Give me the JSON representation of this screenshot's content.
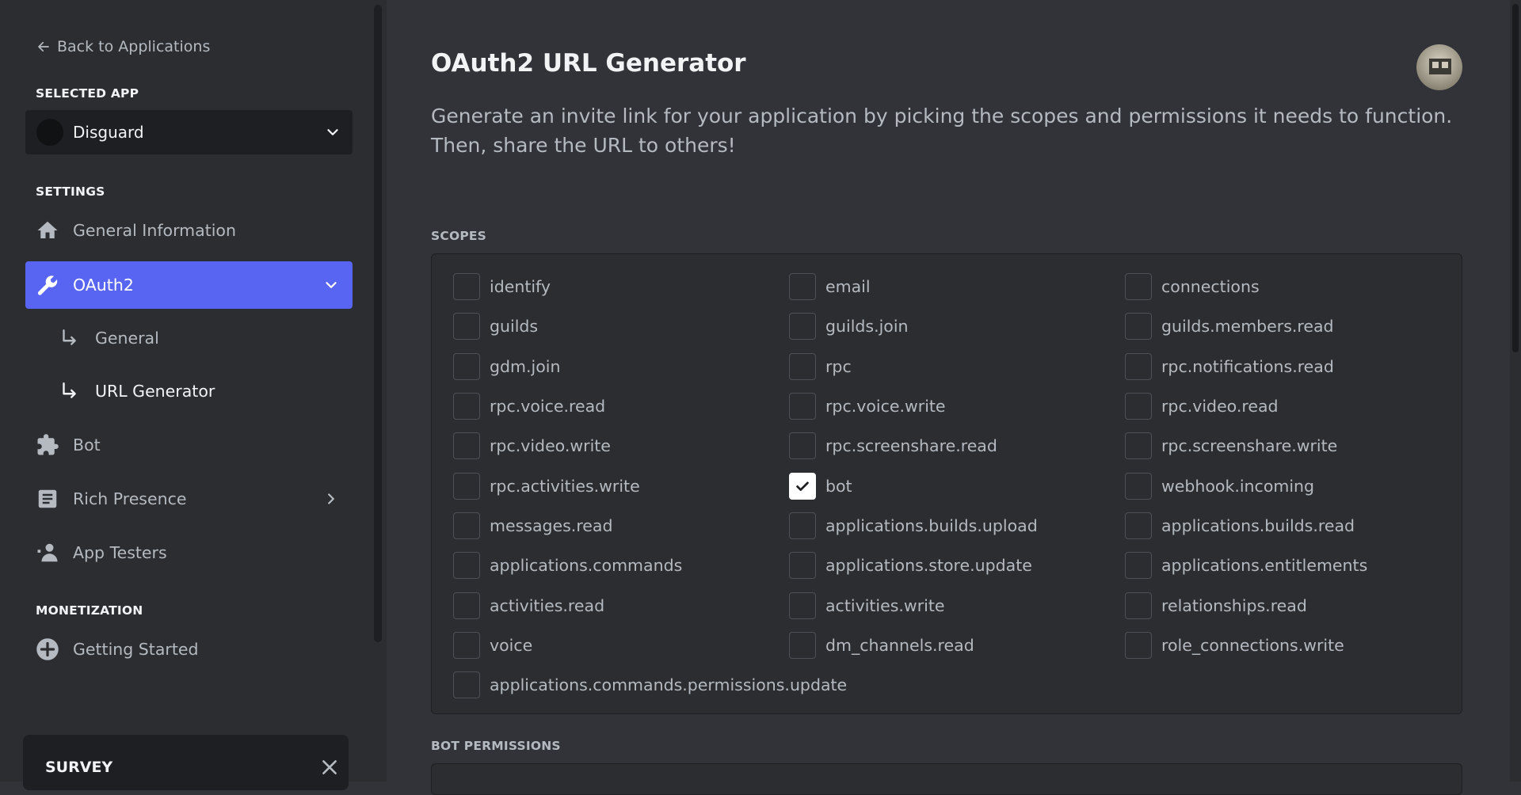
{
  "sidebar": {
    "back_label": "Back to Applications",
    "selected_app_heading": "SELECTED APP",
    "selected_app_name": "Disguard",
    "settings_heading": "SETTINGS",
    "items": [
      {
        "label": "General Information",
        "icon": "home-icon"
      },
      {
        "label": "OAuth2",
        "icon": "wrench-icon",
        "active": true
      },
      {
        "label": "Bot",
        "icon": "puzzle-icon"
      },
      {
        "label": "Rich Presence",
        "icon": "document-icon"
      },
      {
        "label": "App Testers",
        "icon": "user-icon"
      }
    ],
    "oauth_subitems": [
      {
        "label": "General"
      },
      {
        "label": "URL Generator",
        "current": true
      }
    ],
    "monetization_heading": "MONETIZATION",
    "monetization_items": [
      {
        "label": "Getting Started",
        "icon": "plus-circle-icon"
      }
    ],
    "survey_title": "SURVEY"
  },
  "main": {
    "title": "OAuth2 URL Generator",
    "description": "Generate an invite link for your application by picking the scopes and permissions it needs to function. Then, share the URL to others!",
    "scopes_heading": "SCOPES",
    "bot_permissions_heading": "BOT PERMISSIONS",
    "scopes": [
      {
        "name": "identify",
        "checked": false
      },
      {
        "name": "email",
        "checked": false
      },
      {
        "name": "connections",
        "checked": false
      },
      {
        "name": "guilds",
        "checked": false
      },
      {
        "name": "guilds.join",
        "checked": false
      },
      {
        "name": "guilds.members.read",
        "checked": false
      },
      {
        "name": "gdm.join",
        "checked": false
      },
      {
        "name": "rpc",
        "checked": false
      },
      {
        "name": "rpc.notifications.read",
        "checked": false
      },
      {
        "name": "rpc.voice.read",
        "checked": false
      },
      {
        "name": "rpc.voice.write",
        "checked": false
      },
      {
        "name": "rpc.video.read",
        "checked": false
      },
      {
        "name": "rpc.video.write",
        "checked": false
      },
      {
        "name": "rpc.screenshare.read",
        "checked": false
      },
      {
        "name": "rpc.screenshare.write",
        "checked": false
      },
      {
        "name": "rpc.activities.write",
        "checked": false
      },
      {
        "name": "bot",
        "checked": true
      },
      {
        "name": "webhook.incoming",
        "checked": false
      },
      {
        "name": "messages.read",
        "checked": false
      },
      {
        "name": "applications.builds.upload",
        "checked": false
      },
      {
        "name": "applications.builds.read",
        "checked": false
      },
      {
        "name": "applications.commands",
        "checked": false
      },
      {
        "name": "applications.store.update",
        "checked": false
      },
      {
        "name": "applications.entitlements",
        "checked": false
      },
      {
        "name": "activities.read",
        "checked": false
      },
      {
        "name": "activities.write",
        "checked": false
      },
      {
        "name": "relationships.read",
        "checked": false
      },
      {
        "name": "voice",
        "checked": false
      },
      {
        "name": "dm_channels.read",
        "checked": false
      },
      {
        "name": "role_connections.write",
        "checked": false
      },
      {
        "name": "applications.commands.permissions.update",
        "checked": false
      }
    ]
  },
  "colors": {
    "accent": "#5865f2",
    "background": "#313338",
    "sidebar": "#2b2d31"
  }
}
